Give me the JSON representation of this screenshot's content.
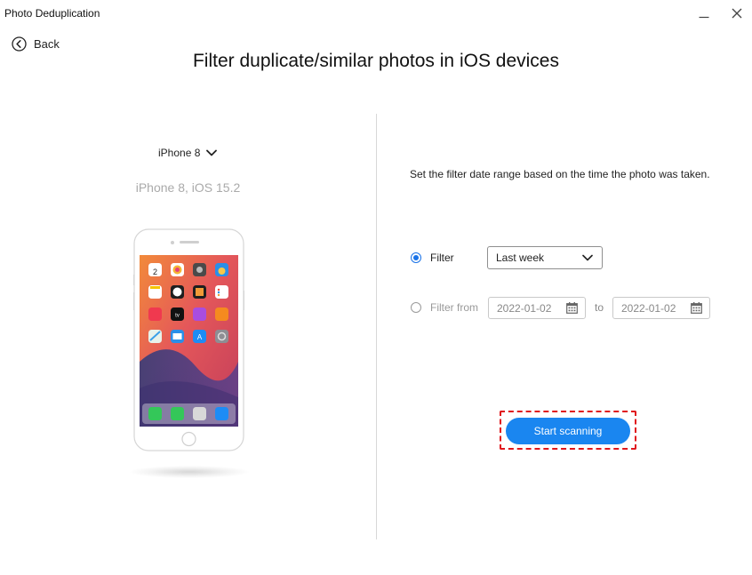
{
  "window": {
    "title": "Photo Deduplication",
    "minimize_icon": "minimize-icon",
    "close_icon": "close-icon"
  },
  "nav": {
    "back_label": "Back",
    "back_icon": "back-arrow-circle-icon"
  },
  "page": {
    "title": "Filter duplicate/similar photos in iOS devices"
  },
  "device": {
    "name": "iPhone 8",
    "info": "iPhone 8, iOS 15.2",
    "chevron_icon": "chevron-down-icon",
    "image": "iphone-home-screen-illustration"
  },
  "filter": {
    "description": "Set the filter date range based on the time the photo was taken.",
    "option_preset_label": "Filter",
    "option_preset_selected": true,
    "preset_value": "Last week",
    "option_range_label": "Filter from",
    "option_range_selected": false,
    "range_from": "2022-01-02",
    "range_to_label": "to",
    "range_to": "2022-01-02",
    "calendar_icon": "calendar-icon"
  },
  "actions": {
    "start_label": "Start scanning"
  },
  "colors": {
    "accent": "#1a86f0",
    "radio_accent": "#1a73e8",
    "highlight": "#e0151b",
    "muted_text": "#aaaaaa"
  }
}
